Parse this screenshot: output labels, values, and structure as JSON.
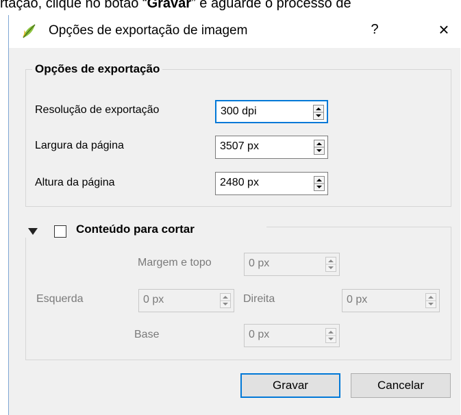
{
  "doc": {
    "text_before": "rtação, clique no botão “",
    "bold": "Gravar",
    "text_after": "” e aguarde o processo de"
  },
  "dialog": {
    "title": "Opções de exportação de imagem",
    "help": "?",
    "close": "×",
    "export_group": {
      "title": "Opções de exportação",
      "resolution_label": "Resolução de exportação",
      "resolution_value": "300 dpi",
      "width_label": "Largura da página",
      "width_value": "3507 px",
      "height_label": "Altura da página",
      "height_value": "2480 px"
    },
    "crop_group": {
      "title": "Conteúdo para cortar",
      "checked": false,
      "top_label": "Margem e topo",
      "top_value": "0 px",
      "left_label": "Esquerda",
      "left_value": "0 px",
      "right_label": "Direita",
      "right_value": "0 px",
      "bottom_label": "Base",
      "bottom_value": "0 px"
    },
    "buttons": {
      "save": "Gravar",
      "cancel": "Cancelar"
    }
  }
}
